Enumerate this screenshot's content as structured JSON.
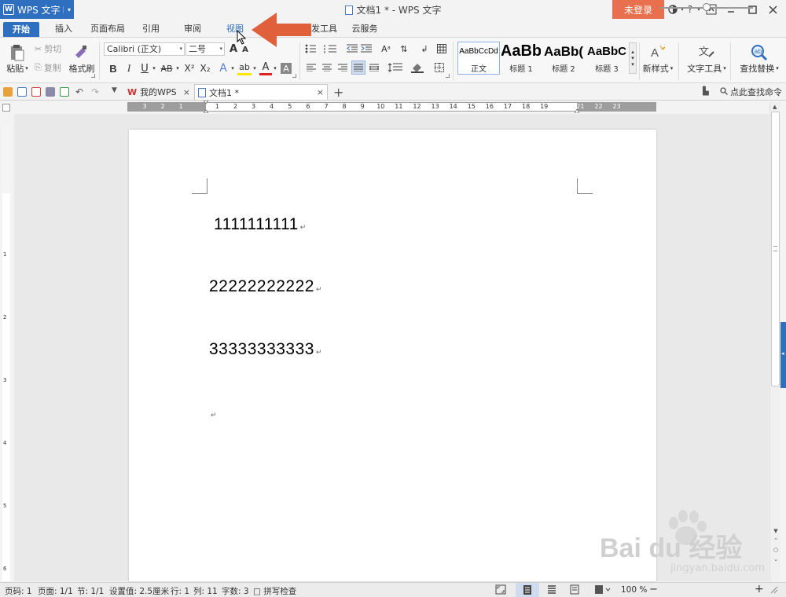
{
  "app": {
    "name": "WPS 文字",
    "logo": "W"
  },
  "window": {
    "title": "文档1 * - WPS 文字",
    "login": "未登录",
    "help": "?"
  },
  "tabs": [
    "开始",
    "插入",
    "页面布局",
    "引用",
    "审阅",
    "视图",
    "开发工具",
    "云服务"
  ],
  "active_tab": "开始",
  "ribbon": {
    "paste": "粘贴",
    "cut": "剪切",
    "copy": "复制",
    "format_painter": "格式刷",
    "font_name": "Calibri (正文)",
    "font_size": "二号",
    "font_grow": "A",
    "font_shrink": "A",
    "bold": "B",
    "italic": "I",
    "underline": "U",
    "strike": "AB",
    "superscript": "X²",
    "subscript": "X₂",
    "text_effect": "A",
    "highlight": "ab",
    "font_color": "A",
    "char_shading": "A",
    "styles": [
      {
        "sample": "AaBbCcDd",
        "label": "正文"
      },
      {
        "sample": "AaBb",
        "label": "标题 1"
      },
      {
        "sample": "AaBb(",
        "label": "标题 2"
      },
      {
        "sample": "AaBbC",
        "label": "标题 3"
      }
    ],
    "new_style": "新样式",
    "text_tools": "文字工具",
    "find_replace": "查找替换"
  },
  "quickbar": {
    "tabs": [
      {
        "label": "我的WPS"
      },
      {
        "label": "文档1 *"
      }
    ],
    "search_command": "点此查找命令"
  },
  "ruler": {
    "h_numbers": [
      "3",
      "2",
      "1",
      "",
      "1",
      "2",
      "3",
      "4",
      "5",
      "6",
      "7",
      "8",
      "9",
      "10",
      "11",
      "12",
      "13",
      "14",
      "15",
      "16",
      "17",
      "18",
      "19",
      "",
      "21",
      "22",
      "23"
    ],
    "v_numbers": [
      "1",
      "2",
      "3",
      "4",
      "5",
      "6"
    ]
  },
  "document": {
    "paragraphs": [
      "1111111111",
      "22222222222",
      "33333333333",
      ""
    ]
  },
  "status": {
    "page_code": "页码: 1",
    "pages": "页面: 1/1",
    "section": "节: 1/1",
    "setting": "设置值: 2.5厘米",
    "row": "行: 1",
    "col": "列: 11",
    "words": "字数: 3",
    "spell": "拼写检查",
    "zoom": "100 %",
    "zoom_level": 1.0
  },
  "watermark": {
    "brand": "Bai du 经验",
    "url": "jingyan.baidu.com"
  },
  "colors": {
    "accent": "#2f6fbf",
    "login": "#e8704e",
    "arrow": "#e0603c"
  }
}
